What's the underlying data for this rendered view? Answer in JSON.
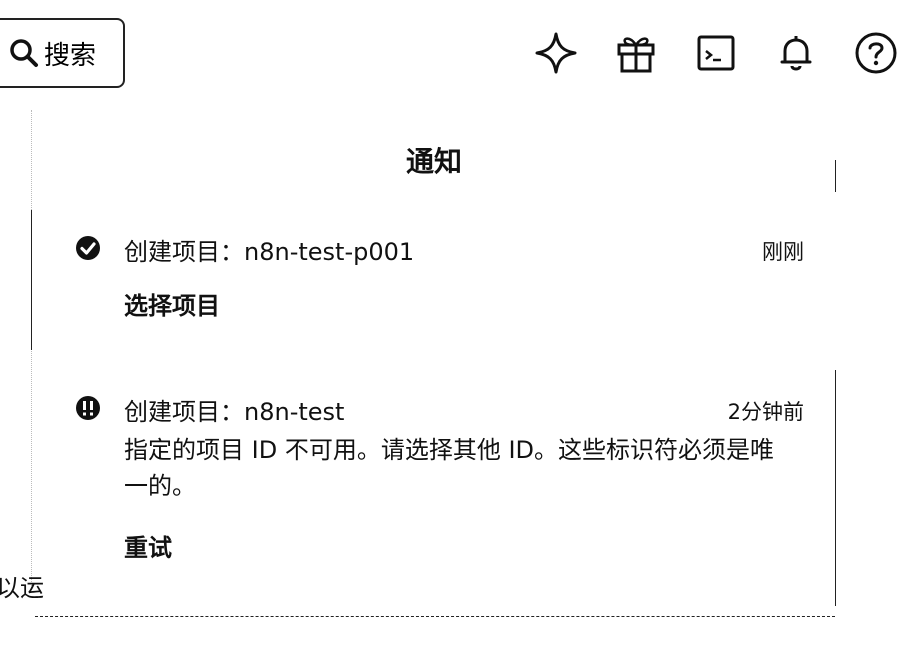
{
  "header": {
    "search_label": "搜索",
    "icons": [
      "sparkle-icon",
      "gift-icon",
      "terminal-icon",
      "bell-icon",
      "help-icon"
    ]
  },
  "background": {
    "partial_text": "以运"
  },
  "notifications": {
    "title": "通知",
    "items": [
      {
        "status": "success",
        "icon": "check-circle-icon",
        "title": "创建项目：n8n-test-p001",
        "time": "刚刚",
        "description": "",
        "action": "选择项目"
      },
      {
        "status": "error",
        "icon": "error-circle-icon",
        "title": "创建项目：n8n-test",
        "time": "2分钟前",
        "description": "指定的项目 ID 不可用。请选择其他 ID。这些标识符必须是唯一的。",
        "action": "重试"
      }
    ]
  }
}
